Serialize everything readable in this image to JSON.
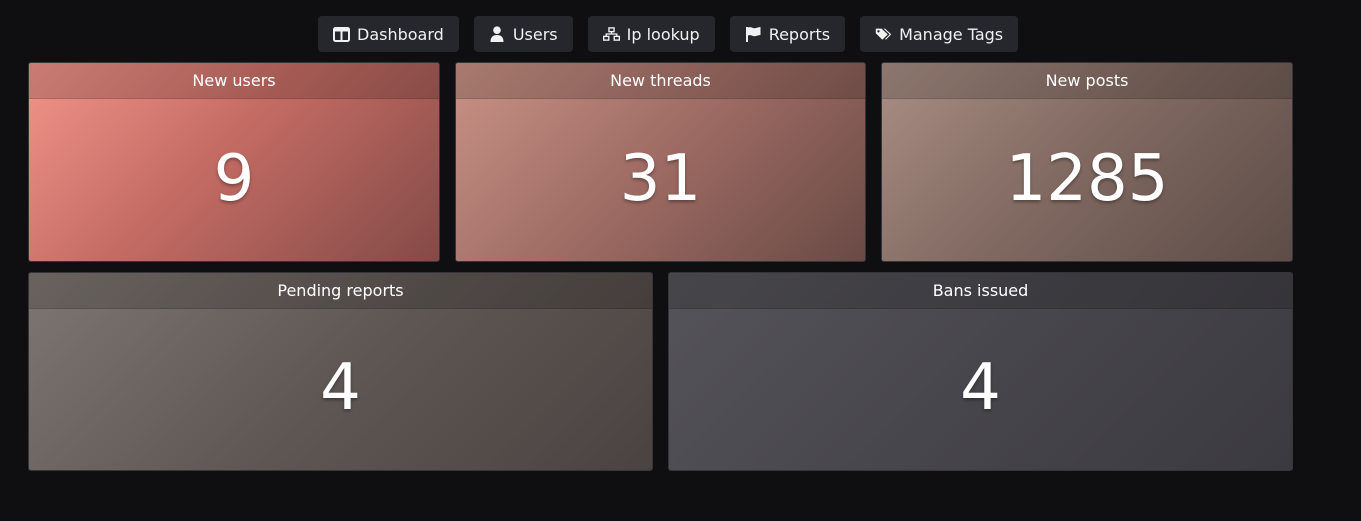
{
  "nav": {
    "items": [
      {
        "label": "Dashboard",
        "icon": "dashboard-icon"
      },
      {
        "label": "Users",
        "icon": "user-icon"
      },
      {
        "label": "Ip lookup",
        "icon": "network-icon"
      },
      {
        "label": "Reports",
        "icon": "flag-icon"
      },
      {
        "label": "Manage Tags",
        "icon": "tags-icon"
      }
    ]
  },
  "stats": {
    "new_users": {
      "label": "New users",
      "value": "9"
    },
    "new_threads": {
      "label": "New threads",
      "value": "31"
    },
    "new_posts": {
      "label": "New posts",
      "value": "1285"
    },
    "pending_reports": {
      "label": "Pending reports",
      "value": "4"
    },
    "bans_issued": {
      "label": "Bans issued",
      "value": "4"
    }
  },
  "colors": {
    "background": "#0f0f11",
    "nav_button": "#26272c",
    "text": "#ffffff"
  }
}
